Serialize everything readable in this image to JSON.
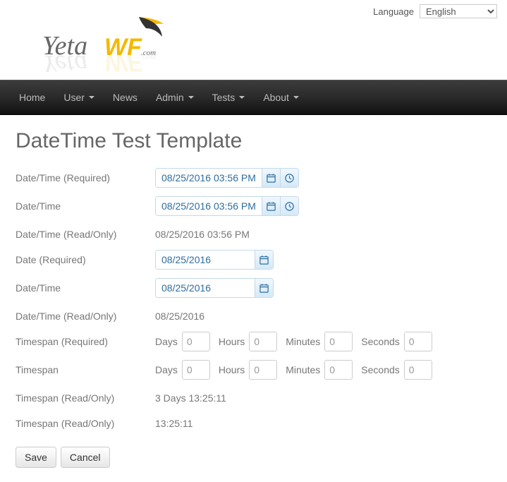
{
  "topbar": {
    "language_label": "Language",
    "language_value": "English"
  },
  "logo": {
    "text_yeta": "Yeta",
    "text_wf": "WF",
    "text_com": ".com"
  },
  "nav": {
    "home": "Home",
    "user": "User",
    "news": "News",
    "admin": "Admin",
    "tests": "Tests",
    "about": "About"
  },
  "page": {
    "title": "DateTime Test Template"
  },
  "fields": {
    "dt_required": {
      "label": "Date/Time (Required)",
      "value": "08/25/2016 03:56 PM"
    },
    "dt": {
      "label": "Date/Time",
      "value": "08/25/2016 03:56 PM"
    },
    "dt_readonly": {
      "label": "Date/Time (Read/Only)",
      "value": "08/25/2016 03:56 PM"
    },
    "date_required": {
      "label": "Date (Required)",
      "value": "08/25/2016"
    },
    "date": {
      "label": "Date/Time",
      "value": "08/25/2016"
    },
    "date_readonly": {
      "label": "Date/Time (Read/Only)",
      "value": "08/25/2016"
    },
    "ts_required": {
      "label": "Timespan (Required)",
      "days_label": "Days",
      "days_value": "0",
      "hours_label": "Hours",
      "hours_value": "0",
      "minutes_label": "Minutes",
      "minutes_value": "0",
      "seconds_label": "Seconds",
      "seconds_value": "0"
    },
    "ts": {
      "label": "Timespan",
      "days_label": "Days",
      "days_value": "0",
      "hours_label": "Hours",
      "hours_value": "0",
      "minutes_label": "Minutes",
      "minutes_value": "0",
      "seconds_label": "Seconds",
      "seconds_value": "0"
    },
    "ts_readonly1": {
      "label": "Timespan (Read/Only)",
      "value": "3 Days 13:25:11"
    },
    "ts_readonly2": {
      "label": "Timespan (Read/Only)",
      "value": "13:25:11"
    }
  },
  "buttons": {
    "save": "Save",
    "cancel": "Cancel"
  }
}
